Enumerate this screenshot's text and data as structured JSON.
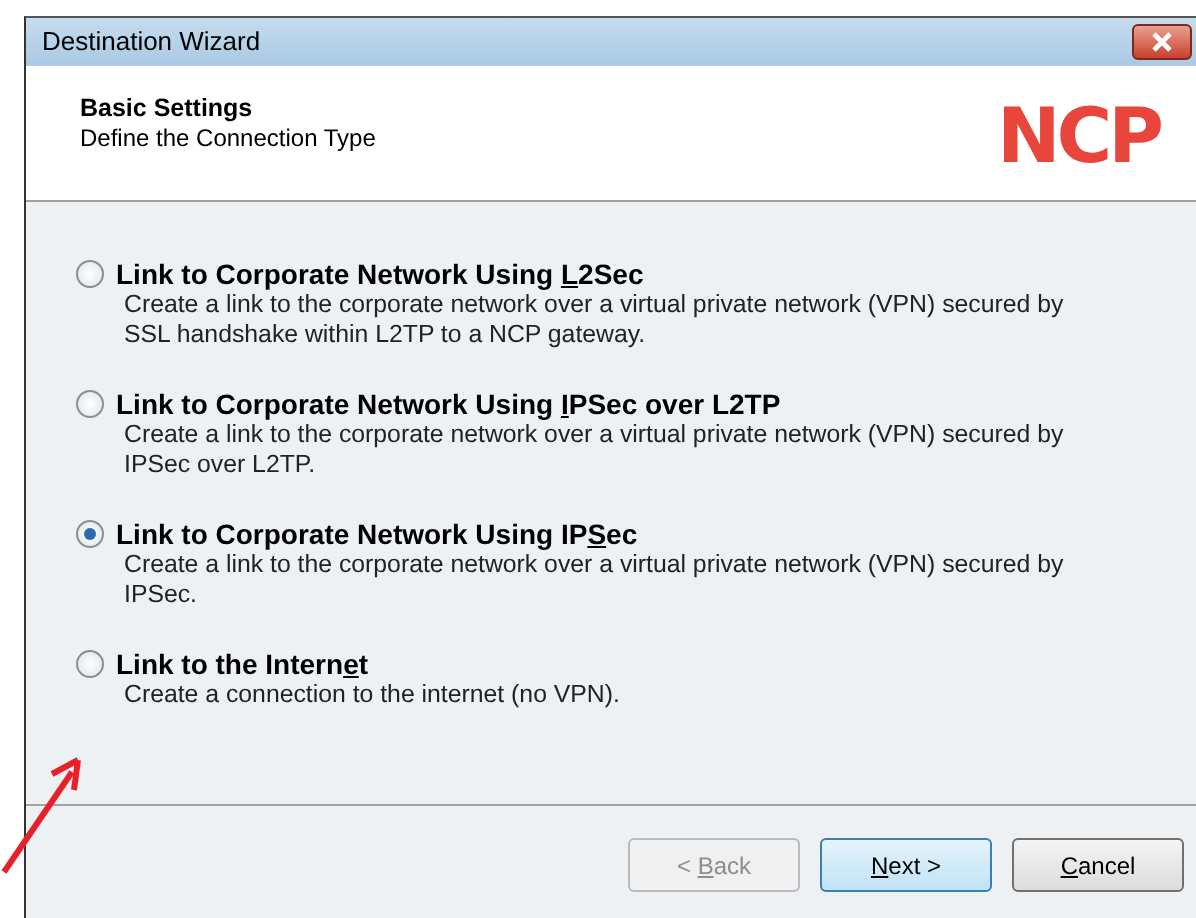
{
  "window": {
    "title": "Destination Wizard"
  },
  "header": {
    "title": "Basic Settings",
    "subtitle": "Define the Connection Type",
    "logo": "NCP"
  },
  "options": [
    {
      "label": [
        "Link to Corporate Network Using ",
        "L",
        "2Sec"
      ],
      "description": "Create a link to the corporate network over a virtual private network (VPN) secured by SSL handshake within L2TP to a NCP gateway.",
      "selected": false
    },
    {
      "label": [
        "Link to Corporate Network Using ",
        "I",
        "PSec over L2TP"
      ],
      "description": "Create a link to the corporate network over a virtual private network (VPN) secured by IPSec over L2TP.",
      "selected": false
    },
    {
      "label": [
        "Link to Corporate Network Using IP",
        "S",
        "ec"
      ],
      "description": "Create a link to the corporate network over a virtual private network (VPN) secured by IPSec.",
      "selected": true
    },
    {
      "label": [
        "Link to the Intern",
        "e",
        "t"
      ],
      "description": "Create a connection to the internet (no VPN).",
      "selected": false
    }
  ],
  "buttons": [
    {
      "label": {
        "before": "< ",
        "key": "B",
        "after": "ack"
      },
      "disabled": true,
      "default": false
    },
    {
      "label": {
        "key": "N",
        "after": "ext >"
      },
      "disabled": false,
      "default": true
    },
    {
      "label": {
        "key": "C",
        "after": "ancel"
      },
      "disabled": false,
      "default": false
    }
  ],
  "annotation": {
    "kind": "arrow"
  }
}
